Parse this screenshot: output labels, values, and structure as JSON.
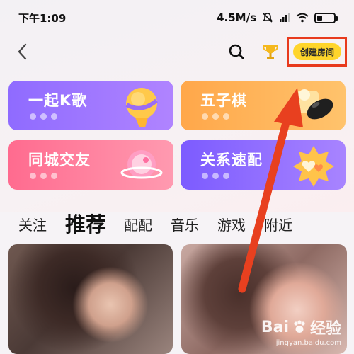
{
  "status_bar": {
    "time": "下午1:09",
    "network_speed": "4.5M/s",
    "battery_level": 0.3
  },
  "header": {
    "create_room_label": "创建房间"
  },
  "cards": [
    {
      "label": "一起K歌",
      "icon": "microphone-icon"
    },
    {
      "label": "五子棋",
      "icon": "gomoku-icon"
    },
    {
      "label": "同城交友",
      "icon": "location-pin-icon"
    },
    {
      "label": "关系速配",
      "icon": "hearts-badge-icon"
    }
  ],
  "tabs": [
    {
      "label": "关注"
    },
    {
      "label": "推荐"
    },
    {
      "label": "配配"
    },
    {
      "label": "音乐"
    },
    {
      "label": "游戏"
    },
    {
      "label": "附近"
    }
  ],
  "watermark": {
    "brand": "Bai",
    "brand_cn": "经验",
    "url": "jingyan.baidu.com"
  },
  "colors": {
    "accent_yellow": "#ffd52b",
    "highlight_red": "#e83a1d"
  }
}
